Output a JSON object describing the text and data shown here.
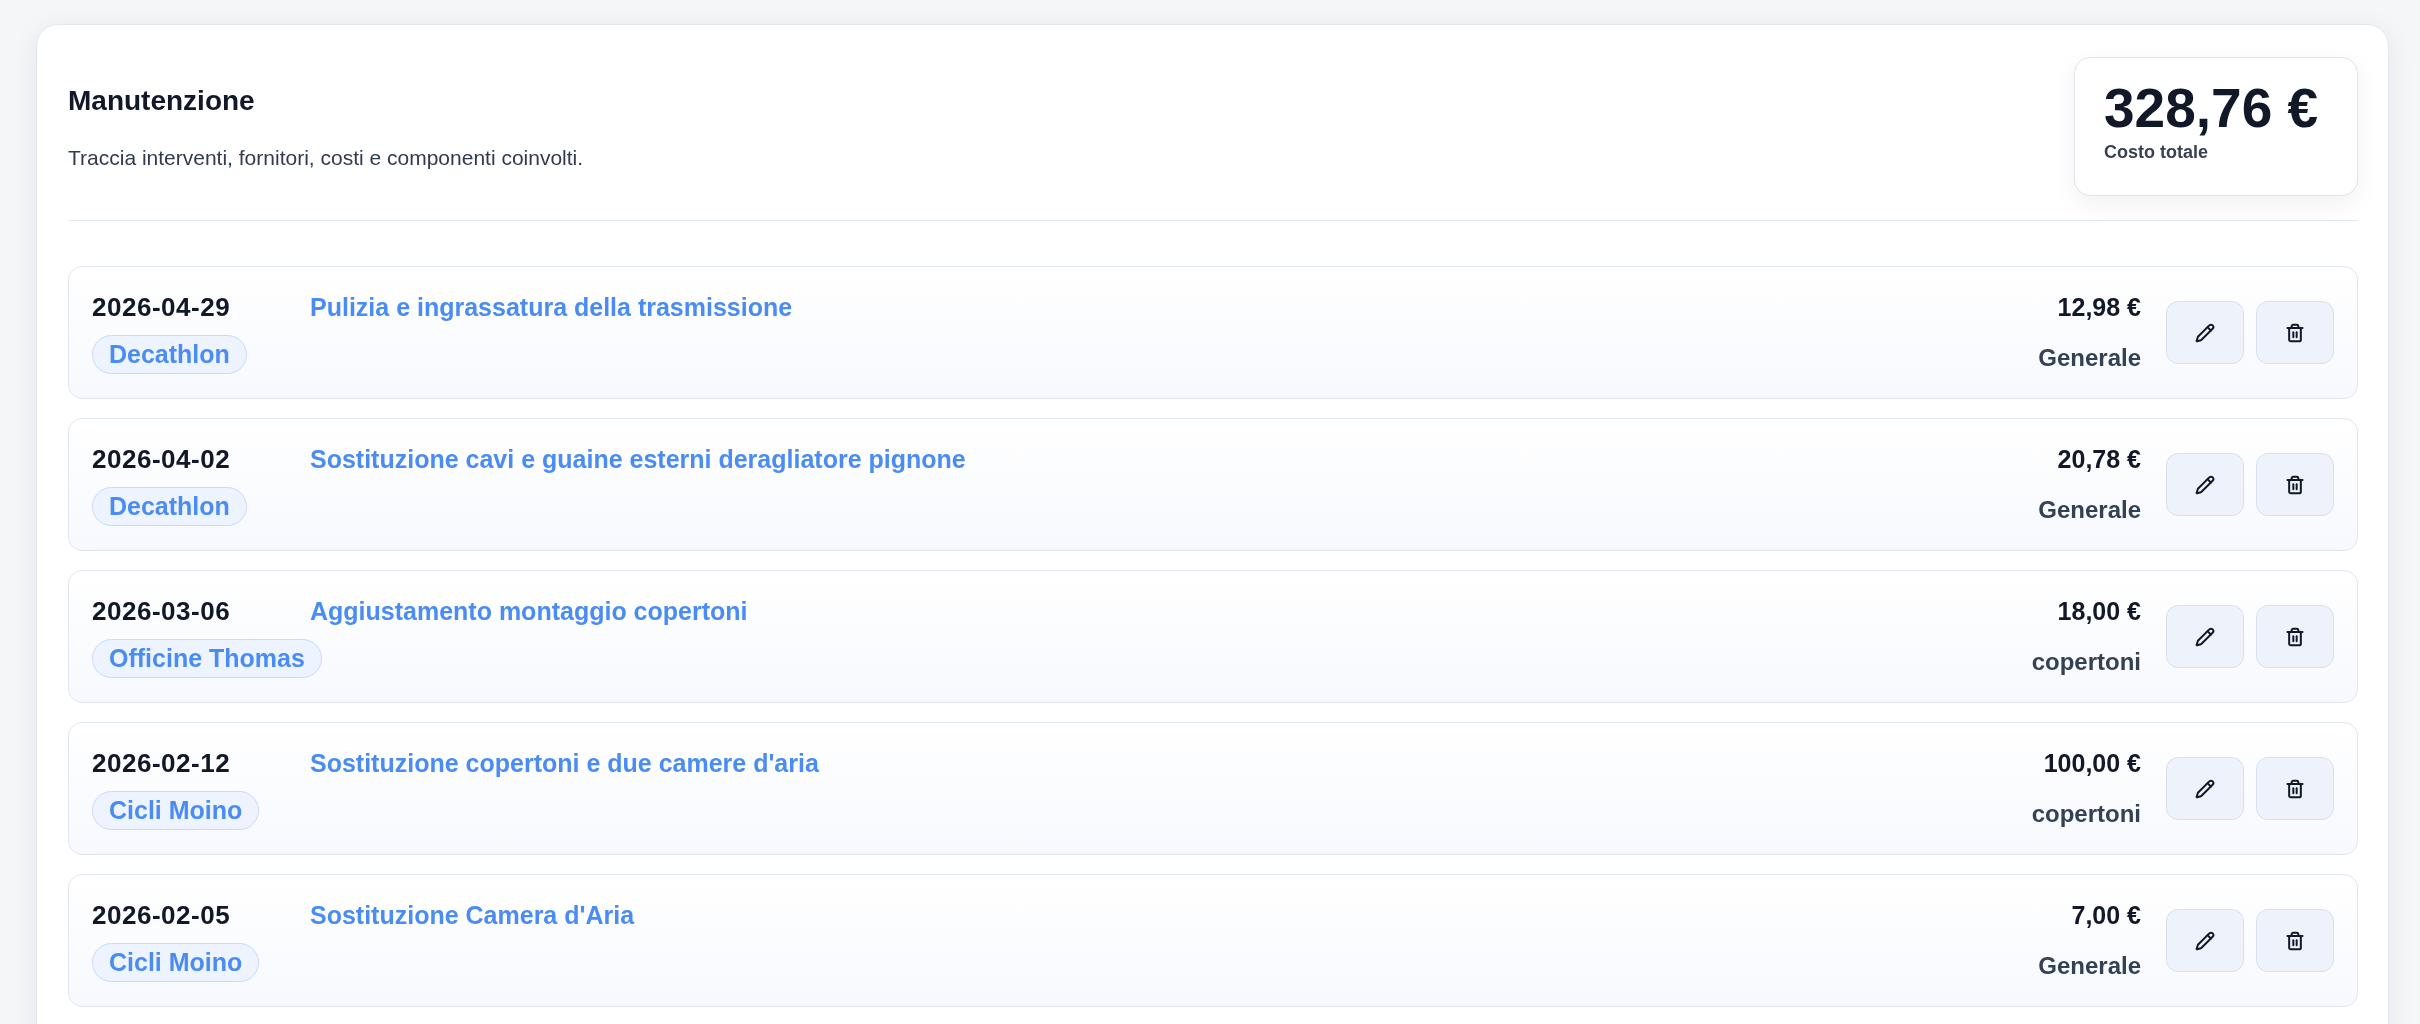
{
  "header": {
    "title": "Manutenzione",
    "subtitle": "Traccia interventi, fornitori, costi e componenti coinvolti."
  },
  "total": {
    "value": "328,76 €",
    "label": "Costo totale"
  },
  "entries": [
    {
      "date": "2026-04-29",
      "supplier": "Decathlon",
      "title": "Pulizia e ingrassatura della trasmissione",
      "cost": "12,98 €",
      "component": "Generale"
    },
    {
      "date": "2026-04-02",
      "supplier": "Decathlon",
      "title": "Sostituzione cavi e guaine esterni deragliatore pignone",
      "cost": "20,78 €",
      "component": "Generale"
    },
    {
      "date": "2026-03-06",
      "supplier": "Officine Thomas",
      "title": "Aggiustamento montaggio copertoni",
      "cost": "18,00 €",
      "component": "copertoni"
    },
    {
      "date": "2026-02-12",
      "supplier": "Cicli Moino",
      "title": "Sostituzione copertoni e due camere d'aria",
      "cost": "100,00 €",
      "component": "copertoni"
    },
    {
      "date": "2026-02-05",
      "supplier": "Cicli Moino",
      "title": "Sostituzione Camera d'Aria",
      "cost": "7,00 €",
      "component": "Generale"
    }
  ]
}
